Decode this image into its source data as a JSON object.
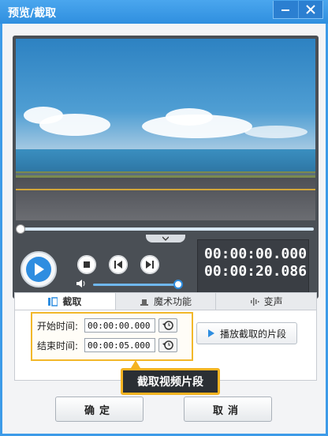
{
  "window": {
    "title": "预览/截取",
    "minimize_icon": "minimize-icon",
    "close_icon": "close-icon"
  },
  "preview": {
    "timeline_progress": 0,
    "volume_level": 0.97,
    "current_time": "00:00:00.000",
    "total_time": "00:00:20.086"
  },
  "tabs": [
    {
      "label": "截取",
      "icon": "clip-icon",
      "active": true
    },
    {
      "label": "魔术功能",
      "icon": "magic-hat-icon",
      "active": false
    },
    {
      "label": "变声",
      "icon": "audio-wave-icon",
      "active": false
    }
  ],
  "clip": {
    "start_label": "开始时间:",
    "start_value": "00:00:00.000",
    "end_label": "结束时间:",
    "end_value": "00:00:05.000",
    "play_clip_label": "播放截取的片段"
  },
  "tooltip": "截取视频片段",
  "buttons": {
    "ok": "确定",
    "cancel": "取消"
  },
  "colors": {
    "titlebar": "#3d9be8",
    "highlight": "#f4b321",
    "accent": "#2e8de0"
  }
}
